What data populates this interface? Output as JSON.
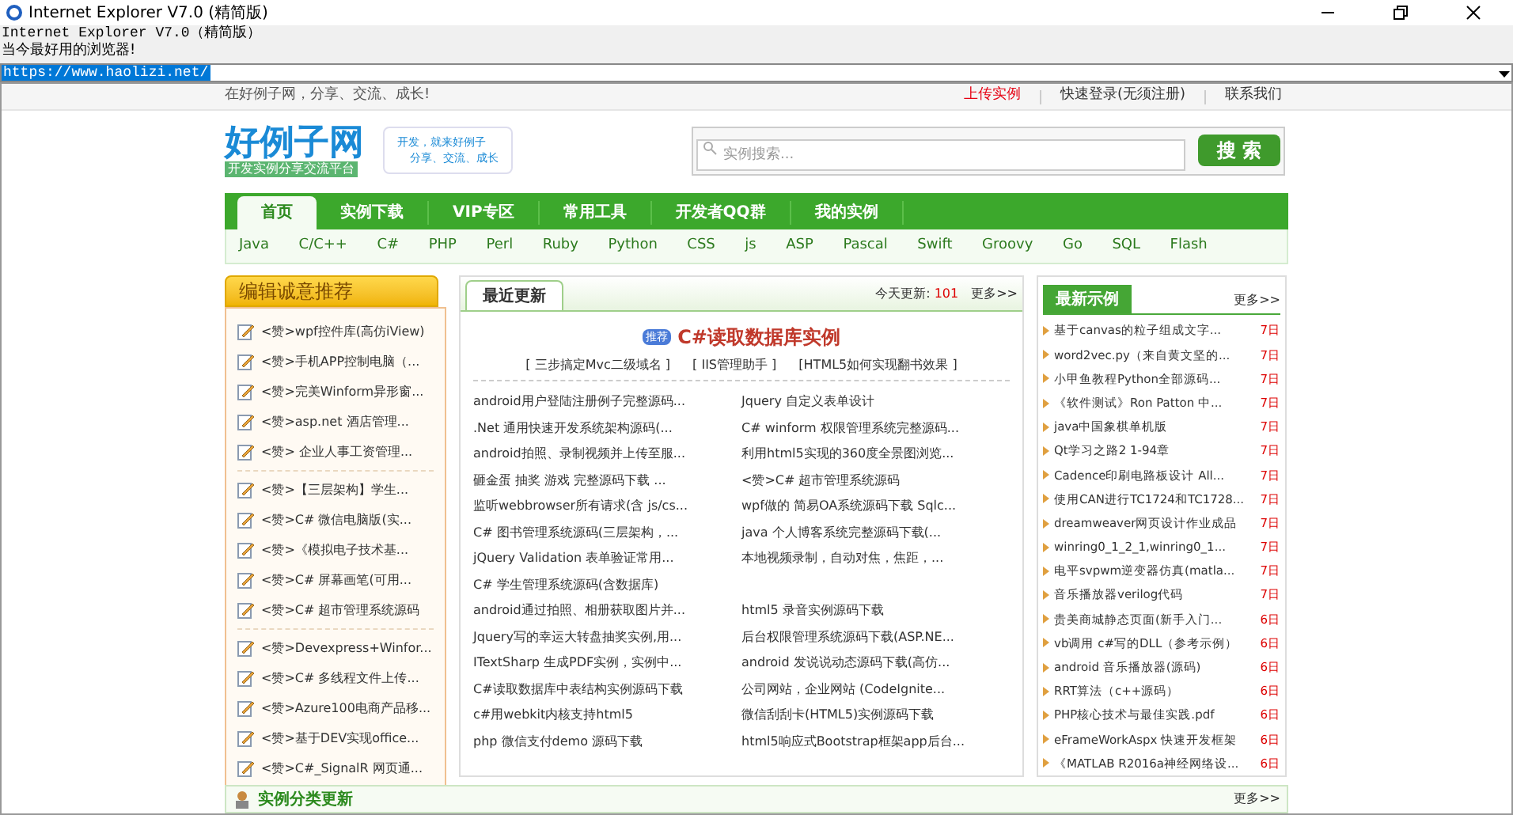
{
  "window": {
    "title": "Internet Explorer V7.0 (精简版)"
  },
  "header_text": {
    "line1": "Internet Explorer V7.0（精简版）",
    "line2": "当今最好用的浏览器!"
  },
  "address_bar": {
    "url": "https://www.haolizi.net/",
    "selected": true
  },
  "top_bar": {
    "slogan": "在好例子网，分享、交流、成长!",
    "links": [
      {
        "label": "上传实例",
        "color": "#e60012"
      },
      {
        "label": "快速登录(无须注册)",
        "color": "#333333"
      },
      {
        "label": "联系我们",
        "color": "#333333"
      }
    ]
  },
  "logo": {
    "title": "好例子网",
    "subtitle": "开发实例分享交流平台"
  },
  "tagline": {
    "line1": "开发，就来好例子",
    "line2": "分享、交流、成长"
  },
  "search": {
    "placeholder": "实例搜索...",
    "button": "搜 索"
  },
  "nav": [
    {
      "label": "首页",
      "selected": true
    },
    {
      "label": "实例下载",
      "selected": false
    },
    {
      "label": "VIP专区",
      "selected": false
    },
    {
      "label": "常用工具",
      "selected": false
    },
    {
      "label": "开发者QQ群",
      "selected": false
    },
    {
      "label": "我的实例",
      "selected": false
    }
  ],
  "languages": [
    "Java",
    "C/C++",
    "C#",
    "PHP",
    "Perl",
    "Ruby",
    "Python",
    "CSS",
    "js",
    "ASP",
    "Pascal",
    "Swift",
    "Groovy",
    "Go",
    "SQL",
    "Flash"
  ],
  "editor_picks": {
    "title": "编辑诚意推荐",
    "groups": [
      [
        "<赞>wpf控件库(高仿iView)",
        "<赞>手机APP控制电脑（...",
        "<赞>完美Winform异形窗...",
        "<赞>asp.net 酒店管理...",
        "<赞> 企业人事工资管理..."
      ],
      [
        "<赞>【三层架构】学生...",
        "<赞>C# 微信电脑版(实...",
        "<赞>《模拟电子技术基...",
        "<赞>C# 屏幕画笔(可用...",
        "<赞>C# 超市管理系统源码"
      ],
      [
        "<赞>Devexpress+Winfor...",
        "<赞>C# 多线程文件上传...",
        "<赞>Azure100电商产品移...",
        "<赞>基于DEV实现office...",
        "<赞>C#_SignalR 网页通..."
      ]
    ]
  },
  "latest": {
    "tab": "最近更新",
    "today_label": "今天更新:",
    "today_count": "101",
    "more": "更多>>",
    "featured": {
      "badge": "推荐",
      "title": "C#读取数据库实例"
    },
    "quick_links": [
      "[ 三步搞定Mvc二级域名 ]",
      "[ IIS管理助手 ]",
      "[HTML5如何实现翻书效果 ]"
    ],
    "rows": [
      [
        "android用户登陆注册例子完整源码...",
        "Jquery 自定义表单设计"
      ],
      [
        ".Net 通用快速开发系统架构源码(...",
        "C# winform 权限管理系统完整源码..."
      ],
      [
        "android拍照、录制视频并上传至服...",
        "利用html5实现的360度全景图浏览..."
      ],
      [
        "砸金蛋 抽奖 游戏 完整源码下载 ...",
        "<赞>C# 超市管理系统源码"
      ],
      [
        "监听webbrowser所有请求(含 js/cs...",
        "wpf做的 简易OA系统源码下载 Sqlc..."
      ],
      [
        "C# 图书管理系统源码(三层架构，...",
        "java 个人博客系统完整源码下载(..."
      ],
      [
        "jQuery Validation 表单验证常用...",
        "本地视频录制，自动对焦，焦距，..."
      ],
      [
        "C# 学生管理系统源码(含数据库)"
      ],
      [
        "android通过拍照、相册获取图片并...",
        "html5 录音实例源码下载"
      ],
      [
        "Jquery写的幸运大转盘抽奖实例,用...",
        "后台权限管理系统源码下载(ASP.NE..."
      ],
      [
        "ITextSharp 生成PDF实例，实例中...",
        "android 发说说动态源码下载(高仿..."
      ],
      [
        "C#读取数据库中表结构实例源码下载",
        "公司网站，企业网站 (CodeIgnite..."
      ],
      [
        "c#用webkit内核支持html5",
        "微信刮刮卡(HTML5)实例源码下载"
      ],
      [
        "php 微信支付demo 源码下载",
        "html5响应式Bootstrap框架app后台..."
      ]
    ]
  },
  "newest": {
    "title": "最新示例",
    "more": "更多>>",
    "items": [
      {
        "text": "基于canvas的粒子组成文字...",
        "date": "7日"
      },
      {
        "text": "word2vec.py（来自黄文坚的...",
        "date": "7日"
      },
      {
        "text": "小甲鱼教程Python全部源码...",
        "date": "7日"
      },
      {
        "text": "《软件测试》Ron Patton 中...",
        "date": "7日"
      },
      {
        "text": "java中国象棋单机版",
        "date": "7日"
      },
      {
        "text": "Qt学习之路2 1-94章",
        "date": "7日"
      },
      {
        "text": "Cadence印刷电路板设计 All...",
        "date": "7日"
      },
      {
        "text": "使用CAN进行TC1724和TC1728...",
        "date": "7日"
      },
      {
        "text": "dreamweaver网页设计作业成品",
        "date": "7日"
      },
      {
        "text": "winring0_1_2_1,winring0_1...",
        "date": "7日"
      },
      {
        "text": "电平svpwm逆变器仿真(matla...",
        "date": "7日"
      },
      {
        "text": "音乐播放器verilog代码",
        "date": "7日"
      },
      {
        "text": "贵美商城静态页面(新手入门...",
        "date": "6日"
      },
      {
        "text": "vb调用 c#写的DLL（参考示例）",
        "date": "6日"
      },
      {
        "text": "android 音乐播放器(源码)",
        "date": "6日"
      },
      {
        "text": "RRT算法（c++源码）",
        "date": "6日"
      },
      {
        "text": "PHP核心技术与最佳实践.pdf",
        "date": "6日"
      },
      {
        "text": "eFrameWorkAspx 快速开发框架",
        "date": "6日"
      },
      {
        "text": "《MATLAB R2016a神经网络设...",
        "date": "6日"
      }
    ]
  },
  "category_update": {
    "title": "实例分类更新",
    "more": "更多>>"
  }
}
